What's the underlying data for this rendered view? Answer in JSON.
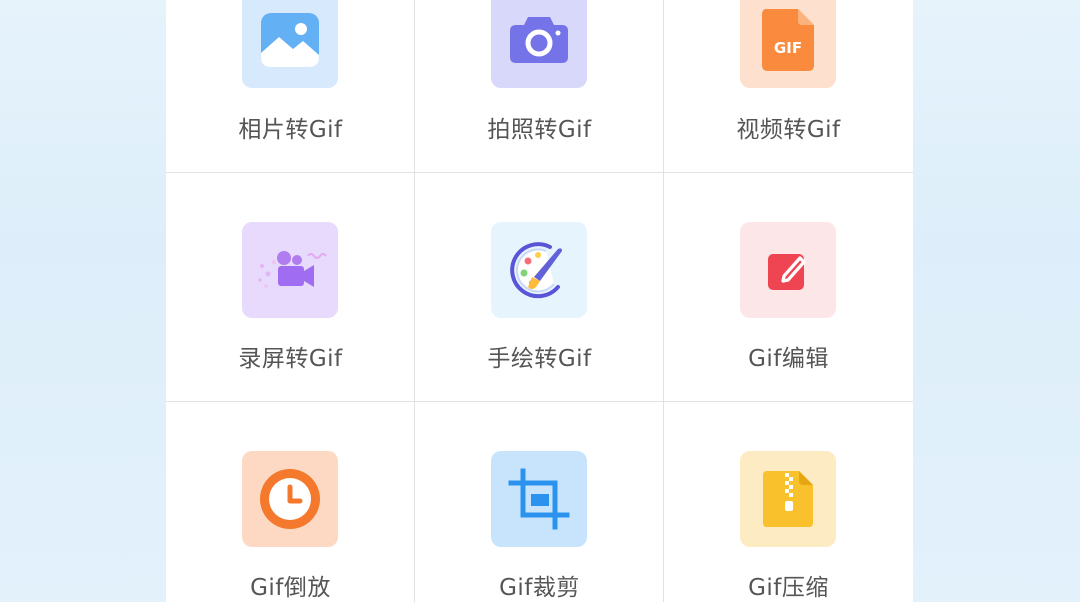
{
  "tools": [
    {
      "label": "相片转Gif",
      "icon": "image-icon",
      "tile_color": "#d7e9fd"
    },
    {
      "label": "拍照转Gif",
      "icon": "camera-icon",
      "tile_color": "#d8d8fa"
    },
    {
      "label": "视频转Gif",
      "icon": "gif-file-icon",
      "tile_color": "#fde0cd"
    },
    {
      "label": "录屏转Gif",
      "icon": "screen-record-icon",
      "tile_color": "#e7dafd"
    },
    {
      "label": "手绘转Gif",
      "icon": "paint-palette-icon",
      "tile_color": "#e6f4fd"
    },
    {
      "label": "Gif编辑",
      "icon": "edit-icon",
      "tile_color": "#fde6e8"
    },
    {
      "label": "Gif倒放",
      "icon": "clock-icon",
      "tile_color": "#fdd9c4"
    },
    {
      "label": "Gif裁剪",
      "icon": "crop-icon",
      "tile_color": "#c8e4fc"
    },
    {
      "label": "Gif压缩",
      "icon": "zip-file-icon",
      "tile_color": "#fdecc3"
    }
  ]
}
